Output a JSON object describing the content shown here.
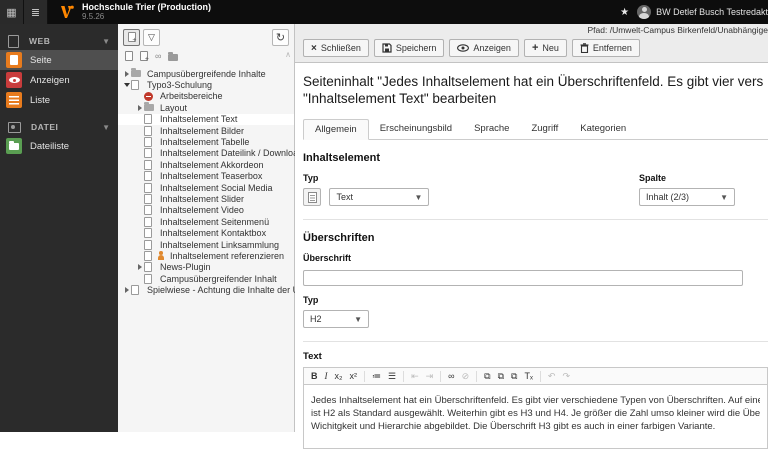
{
  "colors": {
    "accent_orange": "#ff8700",
    "module_orange": "#e87b1d",
    "module_red": "#c83c3c",
    "module_green": "#5a9e52",
    "topbar_bg": "#0d0d0d",
    "sidebar_bg": "#2b2b2b",
    "panel_bg": "#f5f5f5",
    "docheader_bg": "#ececec"
  },
  "topbar": {
    "title": "Hochschule Trier (Production)",
    "version": "9.5.26",
    "user": "BW Detlef Busch Testredakt",
    "icons": [
      "modules-grid-icon",
      "pagetree-list-icon",
      "typo3-logo",
      "star-icon",
      "avatar"
    ]
  },
  "module_menu": {
    "sections": [
      {
        "label": "WEB",
        "icon": "document-icon",
        "items": [
          {
            "label": "Seite",
            "icon": "page-module-icon",
            "color": "#e87b1d",
            "active": true
          },
          {
            "label": "Anzeigen",
            "icon": "view-module-icon",
            "color": "#c83c3c",
            "active": false
          },
          {
            "label": "Liste",
            "icon": "list-module-icon",
            "color": "#e87b1d",
            "active": false
          }
        ]
      },
      {
        "label": "DATEI",
        "icon": "image-icon",
        "items": [
          {
            "label": "Dateiliste",
            "icon": "filelist-module-icon",
            "color": "#5a9e52",
            "active": false
          }
        ]
      }
    ]
  },
  "page_tree": {
    "toolbar": [
      "new-page-button",
      "filter-button",
      "refresh-button"
    ],
    "drag_items": [
      "new-page-icon",
      "new-page-alt-icon",
      "new-link-icon",
      "new-folder-icon"
    ],
    "items": [
      {
        "label": "Campusübergreifende Inhalte",
        "level": 0,
        "toggle": "collapsed",
        "icon": "folder",
        "selected": false
      },
      {
        "label": "Typo3-Schulung",
        "level": 0,
        "toggle": "expanded",
        "icon": "page",
        "selected": false
      },
      {
        "label": "Arbeitsbereiche",
        "level": 1,
        "toggle": "none",
        "icon": "stop",
        "selected": false
      },
      {
        "label": "Layout",
        "level": 1,
        "toggle": "collapsed",
        "icon": "folder",
        "selected": false
      },
      {
        "label": "Inhaltselement Text",
        "level": 1,
        "toggle": "none",
        "icon": "page",
        "selected": true
      },
      {
        "label": "Inhaltselement Bilder",
        "level": 1,
        "toggle": "none",
        "icon": "page",
        "selected": false
      },
      {
        "label": "Inhaltselement Tabelle",
        "level": 1,
        "toggle": "none",
        "icon": "page",
        "selected": false
      },
      {
        "label": "Inhaltselement Dateilink / Download",
        "level": 1,
        "toggle": "none",
        "icon": "page",
        "selected": false
      },
      {
        "label": "Inhaltselement Akkordeon",
        "level": 1,
        "toggle": "none",
        "icon": "page",
        "selected": false
      },
      {
        "label": "Inhaltselement Teaserbox",
        "level": 1,
        "toggle": "none",
        "icon": "page",
        "selected": false
      },
      {
        "label": "Inhaltselement Social Media",
        "level": 1,
        "toggle": "none",
        "icon": "page",
        "selected": false
      },
      {
        "label": "Inhaltselement Slider",
        "level": 1,
        "toggle": "none",
        "icon": "page",
        "selected": false
      },
      {
        "label": "Inhaltselement Video",
        "level": 1,
        "toggle": "none",
        "icon": "page",
        "selected": false
      },
      {
        "label": "Inhaltselement Seitenmenü",
        "level": 1,
        "toggle": "none",
        "icon": "page",
        "selected": false
      },
      {
        "label": "Inhaltselement Kontaktbox",
        "level": 1,
        "toggle": "none",
        "icon": "page",
        "selected": false
      },
      {
        "label": "Inhaltselement Linksammlung",
        "level": 1,
        "toggle": "none",
        "icon": "page",
        "selected": false
      },
      {
        "label": "Inhaltselement referenzieren",
        "level": 1,
        "toggle": "none",
        "icon": "page-reference",
        "selected": false
      },
      {
        "label": "News-Plugin",
        "level": 1,
        "toggle": "collapsed",
        "icon": "page",
        "selected": false
      },
      {
        "label": "Campusübergreifender Inhalt",
        "level": 1,
        "toggle": "none",
        "icon": "page",
        "selected": false
      },
      {
        "label": "Spielwiese - Achtung die Inhalte der Un",
        "level": 0,
        "toggle": "collapsed",
        "icon": "page",
        "selected": false
      }
    ]
  },
  "docheader": {
    "path_label": "Pfad:",
    "path_value": "/Umwelt-Campus Birkenfeld/Unabhängige",
    "buttons": [
      {
        "label": "Schließen",
        "icon": "close-icon"
      },
      {
        "label": "Speichern",
        "icon": "save-icon"
      },
      {
        "label": "Anzeigen",
        "icon": "view-icon"
      },
      {
        "label": "Neu",
        "icon": "plus-icon"
      },
      {
        "label": "Entfernen",
        "icon": "delete-icon"
      }
    ]
  },
  "content": {
    "heading_line1": "Seiteninhalt \"Jedes Inhaltselement hat ein Überschriftenfeld. Es gibt vier vers",
    "heading_line2": "\"Inhaltselement Text\" bearbeiten",
    "tabs": [
      {
        "label": "Allgemein",
        "active": true
      },
      {
        "label": "Erscheinungsbild",
        "active": false
      },
      {
        "label": "Sprache",
        "active": false
      },
      {
        "label": "Zugriff",
        "active": false
      },
      {
        "label": "Kategorien",
        "active": false
      }
    ],
    "section_inhaltselement": {
      "title": "Inhaltselement",
      "typ_label": "Typ",
      "typ_value": "Text",
      "spalte_label": "Spalte",
      "spalte_value": "Inhalt (2/3)"
    },
    "section_ueberschriften": {
      "title": "Überschriften",
      "ueberschrift_label": "Überschrift",
      "ueberschrift_value": "",
      "typ_label": "Typ",
      "typ_value": "H2"
    },
    "section_text": {
      "title": "Text",
      "rte_toolbar": [
        {
          "name": "bold-icon",
          "glyph": "B",
          "disabled": false
        },
        {
          "name": "italic-icon",
          "glyph": "I",
          "disabled": false
        },
        {
          "name": "subscript-icon",
          "glyph": "x₂",
          "disabled": false
        },
        {
          "name": "superscript-icon",
          "glyph": "x²",
          "disabled": false
        },
        {
          "sep": true
        },
        {
          "name": "ordered-list-icon",
          "glyph": "≔",
          "disabled": false
        },
        {
          "name": "unordered-list-icon",
          "glyph": "☰",
          "disabled": false
        },
        {
          "sep": true
        },
        {
          "name": "outdent-icon",
          "glyph": "⇤",
          "disabled": true
        },
        {
          "name": "indent-icon",
          "glyph": "⇥",
          "disabled": true
        },
        {
          "sep": true
        },
        {
          "name": "link-icon",
          "glyph": "∞",
          "disabled": false
        },
        {
          "name": "unlink-icon",
          "glyph": "⊘",
          "disabled": true
        },
        {
          "sep": true
        },
        {
          "name": "paste-icon",
          "glyph": "⧉",
          "disabled": false
        },
        {
          "name": "paste-text-icon",
          "glyph": "⧉",
          "disabled": false
        },
        {
          "name": "paste-word-icon",
          "glyph": "⧉",
          "disabled": false
        },
        {
          "name": "remove-format-icon",
          "glyph": "Tₓ",
          "disabled": false
        },
        {
          "sep": true
        },
        {
          "name": "undo-icon",
          "glyph": "↶",
          "disabled": true
        },
        {
          "name": "redo-icon",
          "glyph": "↷",
          "disabled": true
        }
      ],
      "lines": [
        "Jedes Inhaltselement hat ein Überschriftenfeld. Es gibt vier verschiedene Typen von Überschriften. Auf einer Seite da",
        "ist H2 als Standard ausgewählt. Weiterhin gibt es H3 und H4. Je größer die Zahl umso kleiner wird die Überschrift dar",
        "Wichitgkeit und Hierarchie abgebildet. Die Überschrift H3 gibt es auch in einer farbigen Variante."
      ]
    }
  }
}
